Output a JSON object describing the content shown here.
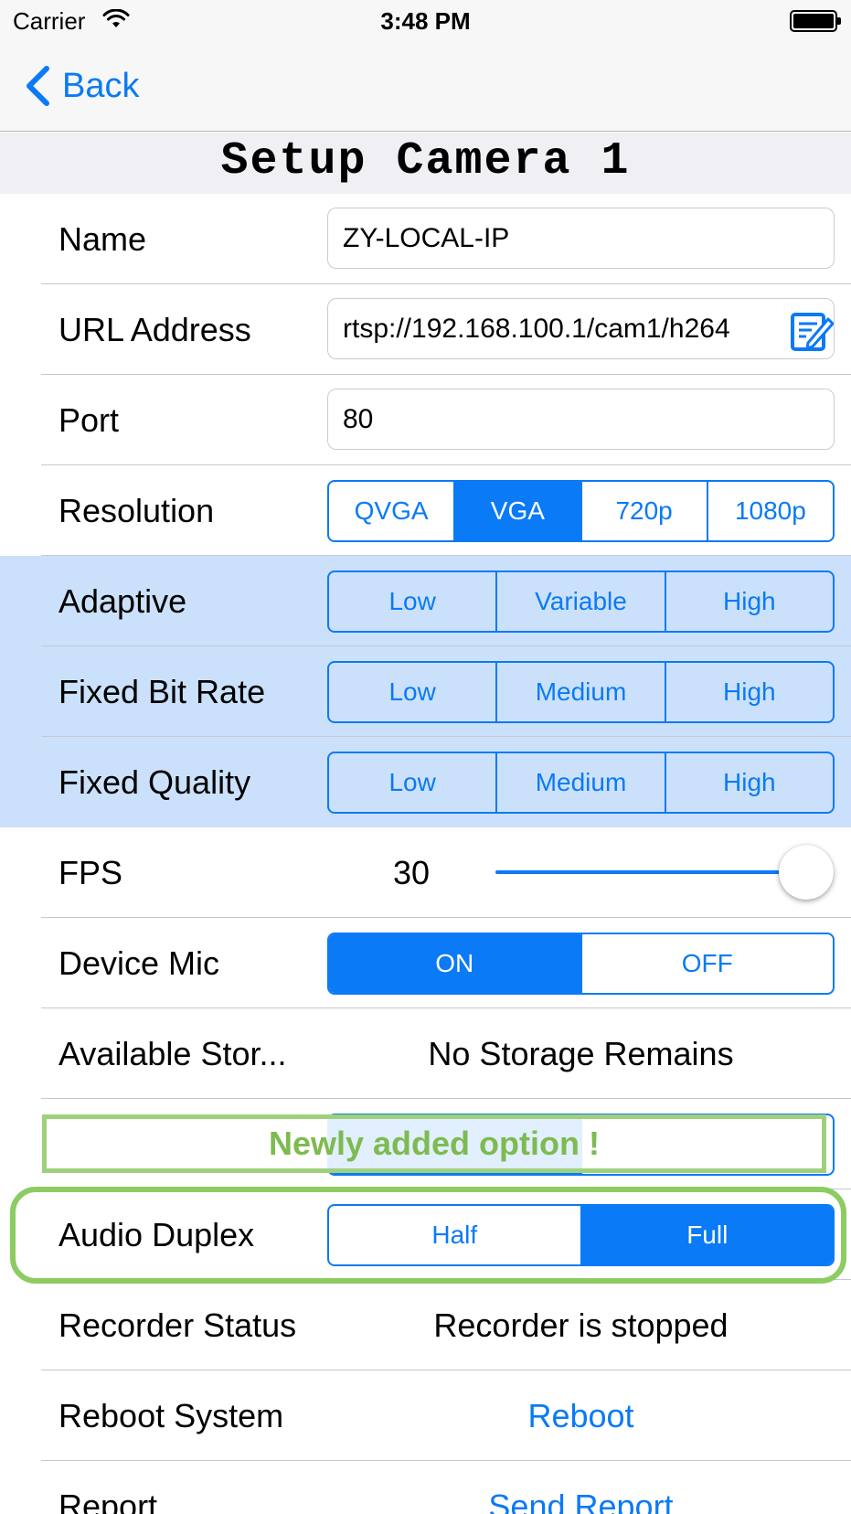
{
  "status_bar": {
    "carrier": "Carrier",
    "time": "3:48 PM"
  },
  "nav": {
    "back_label": "Back"
  },
  "header": {
    "title": "Setup Camera 1"
  },
  "rows": {
    "name": {
      "label": "Name",
      "value": "ZY-LOCAL-IP"
    },
    "url": {
      "label": "URL Address",
      "value": "rtsp://192.168.100.1/cam1/h264"
    },
    "port": {
      "label": "Port",
      "value": "80"
    },
    "resolution": {
      "label": "Resolution",
      "options": [
        "QVGA",
        "VGA",
        "720p",
        "1080p"
      ],
      "selected": "VGA"
    },
    "adaptive": {
      "label": "Adaptive",
      "options": [
        "Low",
        "Variable",
        "High"
      ]
    },
    "fixed_bit_rate": {
      "label": "Fixed Bit Rate",
      "options": [
        "Low",
        "Medium",
        "High"
      ]
    },
    "fixed_quality": {
      "label": "Fixed Quality",
      "options": [
        "Low",
        "Medium",
        "High"
      ]
    },
    "fps": {
      "label": "FPS",
      "value": "30",
      "slider_fraction": 1.0
    },
    "device_mic": {
      "label": "Device Mic",
      "options": [
        "ON",
        "OFF"
      ],
      "selected": "ON"
    },
    "available_storage": {
      "label": "Available Stor...",
      "value": "No Storage Remains"
    },
    "audio_duplex": {
      "label": "Audio Duplex",
      "options": [
        "Half",
        "Full"
      ],
      "selected": "Full"
    },
    "recorder_status": {
      "label": "Recorder Status",
      "value": "Recorder is stopped"
    },
    "reboot_system": {
      "label": "Reboot System",
      "action": "Reboot"
    },
    "report": {
      "label": "Report",
      "action": "Send Report"
    }
  },
  "callout": {
    "text": "Newly added option !"
  },
  "colors": {
    "accent": "#0a7af6",
    "highlight_row": "#cbe1fb",
    "callout_green": "#8ccc63",
    "header_bg": "#efeff4"
  },
  "icons": {
    "back": "chevron-left-icon",
    "wifi": "wifi-icon",
    "battery": "battery-icon",
    "url_edit": "edit-note-icon"
  }
}
